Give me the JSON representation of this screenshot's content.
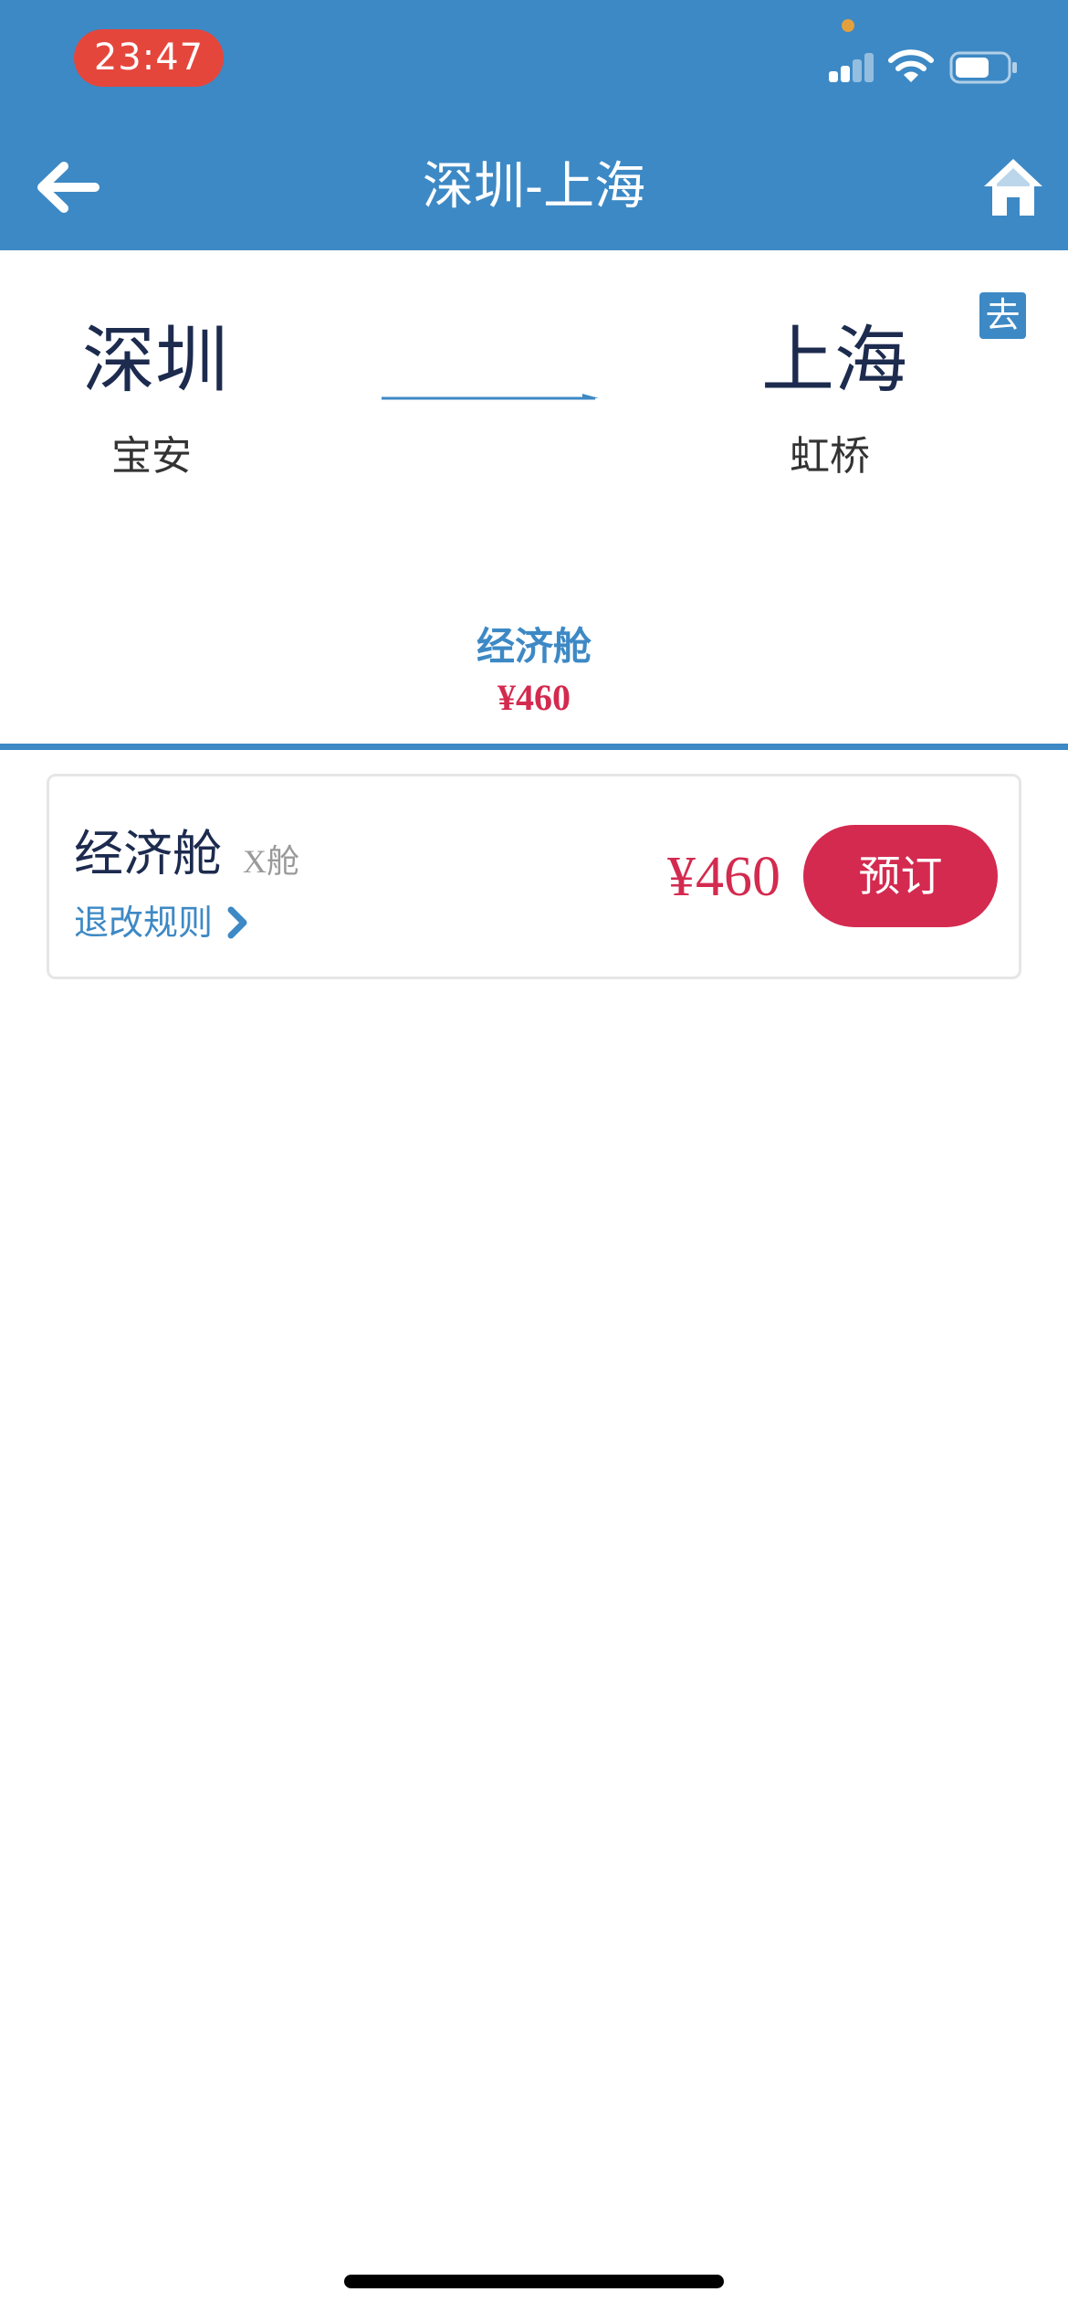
{
  "status_bar": {
    "time": "23:47",
    "icons": [
      "signal-icon",
      "wifi-icon",
      "battery-icon"
    ]
  },
  "nav": {
    "title": "深圳-上海",
    "back_icon": "back-arrow-icon",
    "home_icon": "home-icon"
  },
  "route": {
    "from_city": "深圳",
    "from_airport": "宝安",
    "to_city": "上海",
    "to_airport": "虹桥",
    "direction_badge": "去"
  },
  "cabin_tab": {
    "label": "经济舱",
    "price": "¥460"
  },
  "fare": {
    "name": "经济舱",
    "class_code": "X舱",
    "rules_link": "退改规则",
    "price": "¥460",
    "book_label": "预订"
  },
  "colors": {
    "primary": "#3d89c5",
    "price": "#d42a4f",
    "time_pill": "#e5463c"
  }
}
